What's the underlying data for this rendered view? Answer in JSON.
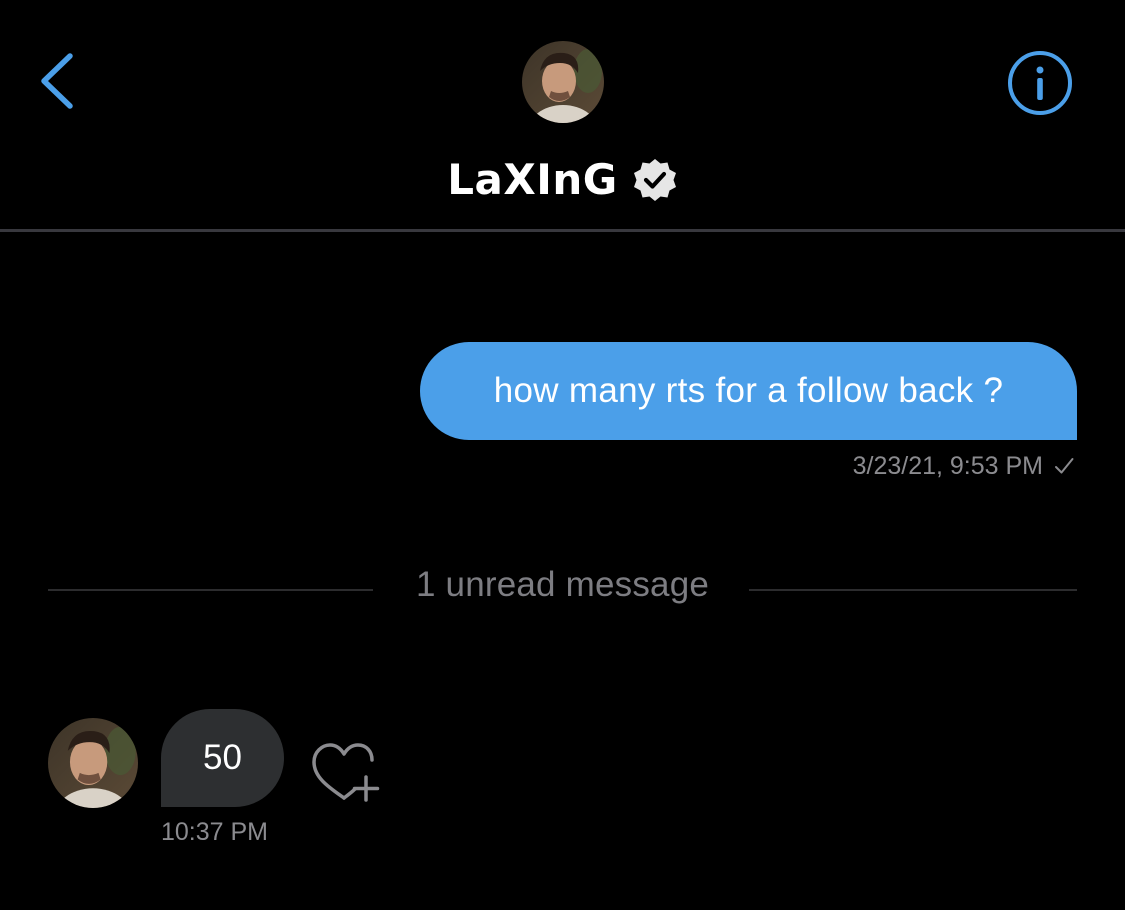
{
  "header": {
    "contact_name": "LaXInG",
    "back_icon": "chevron-left-icon",
    "info_icon": "info-circle-icon",
    "verified_icon": "verified-badge-icon",
    "accent_color": "#4b9fe9"
  },
  "messages": {
    "sent": {
      "text": "how many rts for a follow back ?",
      "timestamp": "3/23/21, 9:53 PM",
      "status_icon": "checkmark-icon",
      "bubble_color": "#4b9fe9"
    },
    "unread_divider": "1 unread message",
    "received": {
      "text": "50",
      "timestamp": "10:37 PM",
      "bubble_color": "#2d2f31",
      "react_icon": "heart-plus-icon"
    }
  }
}
